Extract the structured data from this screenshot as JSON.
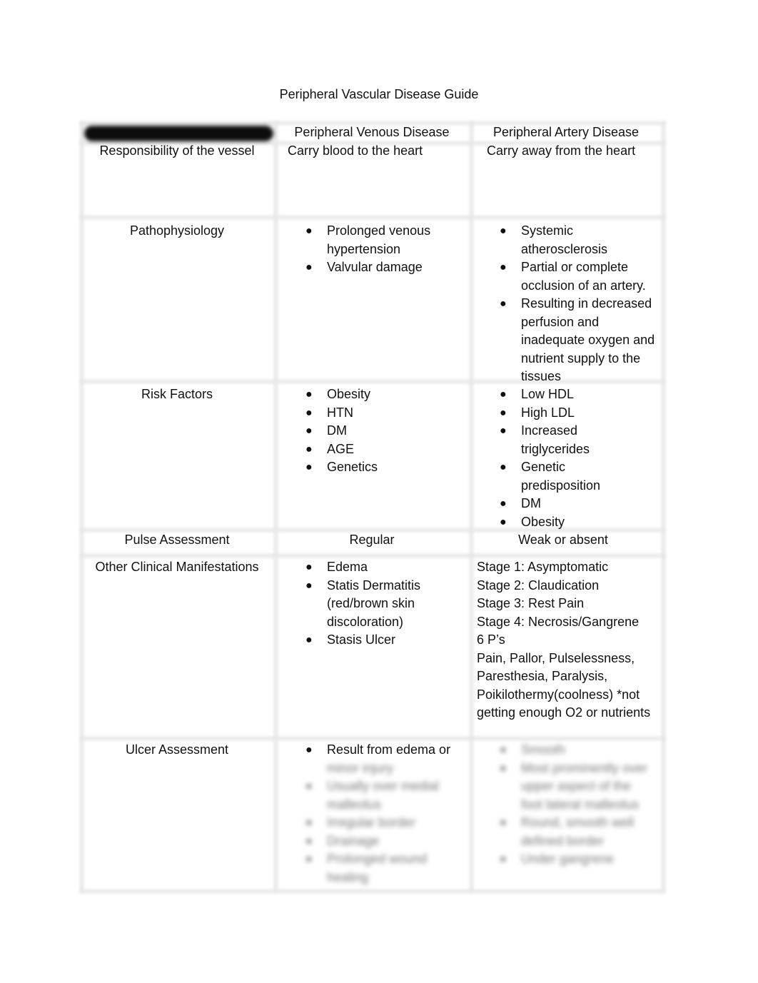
{
  "document": {
    "title": "Peripheral Vascular Disease Guide",
    "columns": {
      "col0_header": "[redacted]",
      "col1_header": "Peripheral Venous Disease",
      "col2_header": "Peripheral Artery Disease"
    },
    "rows": {
      "responsibility": {
        "label": "Responsibility of the vessel",
        "venous": "Carry blood to the heart",
        "arterial": "Carry away from the heart"
      },
      "pathophysiology": {
        "label": "Pathophysiology",
        "venous": [
          "Prolonged venous hypertension",
          "Valvular damage"
        ],
        "arterial": [
          "Systemic atherosclerosis",
          "Partial or complete occlusion of an artery.",
          "Resulting in decreased perfusion and inadequate oxygen and nutrient supply to the tissues"
        ]
      },
      "risk_factors": {
        "label": "Risk Factors",
        "venous": [
          "Obesity",
          "HTN",
          "DM",
          "AGE",
          "Genetics"
        ],
        "arterial": [
          "Low HDL",
          "High LDL",
          "Increased triglycerides",
          "Genetic predisposition",
          "DM",
          "Obesity"
        ]
      },
      "pulse": {
        "label": "Pulse Assessment",
        "venous": "Regular",
        "arterial": "Weak or absent"
      },
      "other_manifestations": {
        "label": "Other Clinical Manifestations",
        "venous": [
          "Edema",
          "Statis Dermatitis (red/brown skin discoloration)",
          "Stasis Ulcer"
        ],
        "arterial_lines": [
          "Stage 1: Asymptomatic",
          "Stage 2: Claudication",
          "Stage 3: Rest Pain",
          "Stage 4: Necrosis/Gangrene",
          "6 P’s",
          "Pain, Pallor, Pulselessness, Paresthesia, Paralysis, Poikilothermy(coolness) *not getting enough O2 or nutrients"
        ]
      },
      "ulcer": {
        "label": "Ulcer Assessment",
        "venous_visible": "Result from edema or",
        "venous_blurred": [
          "minor injury",
          "Usually over medial malleolus",
          "Irregular border",
          "Drainage",
          "Prolonged wound healing"
        ],
        "arterial_blurred": [
          "Smooth",
          "Most prominently over upper aspect of the foot lateral malleolus",
          "Round, smooth well defined border",
          "Under gangrene"
        ]
      }
    }
  }
}
